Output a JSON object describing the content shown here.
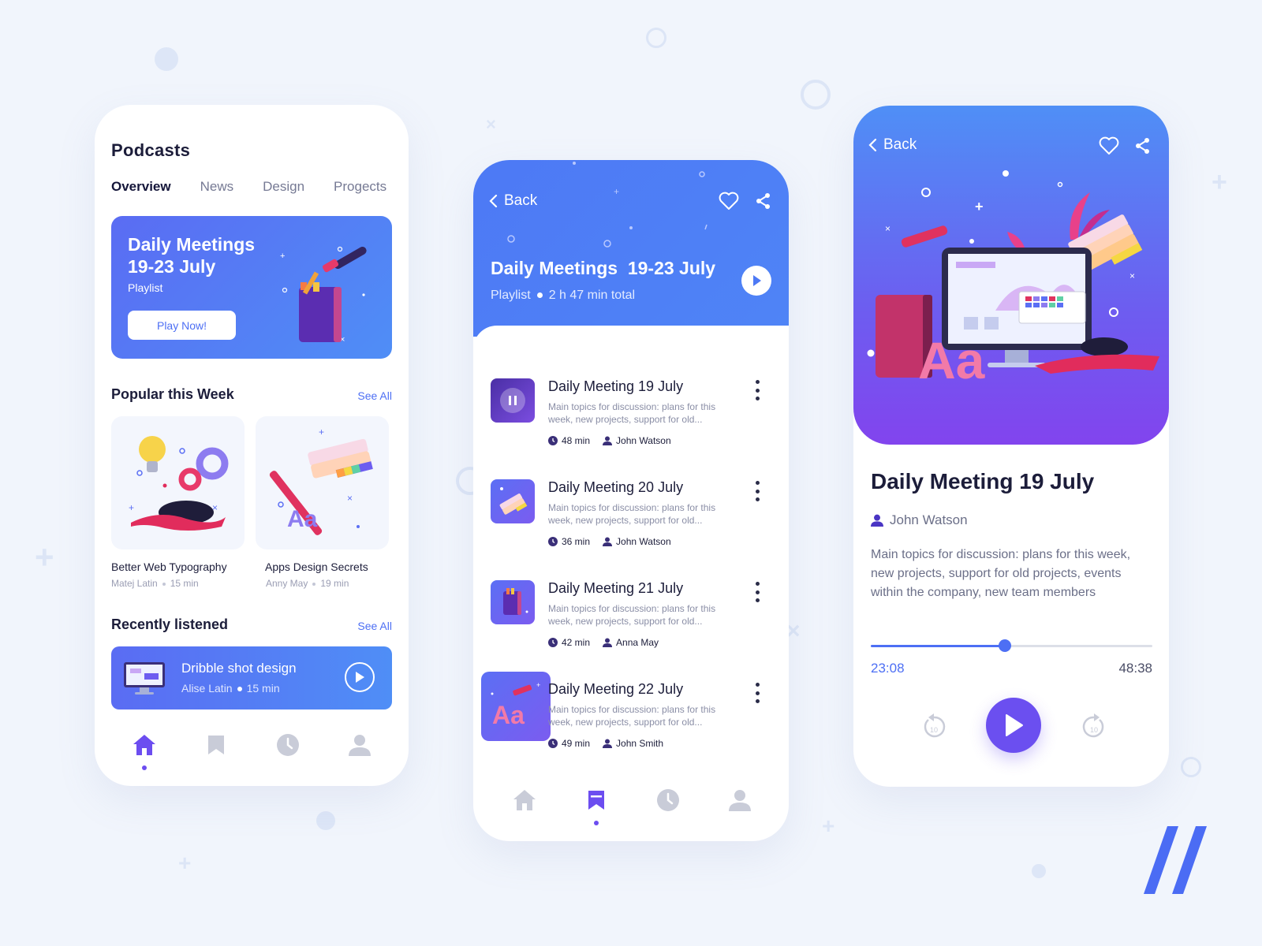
{
  "colors": {
    "accent": "#4d6ff4",
    "purple": "#6b4ff0",
    "bg": "#f1f5fc"
  },
  "overview": {
    "title": "Podcasts",
    "tabs": [
      "Overview",
      "News",
      "Design",
      "Progects"
    ],
    "hero": {
      "title": "Daily Meetings 19-23 July",
      "subtitle": "Playlist",
      "button": "Play Now!"
    },
    "popular": {
      "title": "Popular this Week",
      "see_all": "See All",
      "items": [
        {
          "title": "Better Web Typography",
          "author": "Matej Latin",
          "duration": "15 min"
        },
        {
          "title": "Apps Design Secrets",
          "author": "Anny May",
          "duration": "19 min"
        }
      ]
    },
    "recent": {
      "title": "Recently listened",
      "see_all": "See All",
      "item": {
        "title": "Dribble shot design",
        "author": "Alise Latin",
        "duration": "15 min"
      }
    },
    "nav": [
      "home-icon",
      "bookmark-icon",
      "clock-icon",
      "user-icon"
    ],
    "active_nav": "home"
  },
  "playlist": {
    "back": "Back",
    "title": "Daily Meetings  19-23 July",
    "subtitle": "Playlist",
    "total": "2 h 47 min total",
    "episodes": [
      {
        "title": "Daily Meeting 19 July",
        "desc": "Main topics for discussion: plans for this week, new projects, support for old...",
        "duration": "48 min",
        "author": "John Watson"
      },
      {
        "title": "Daily Meeting 20 July",
        "desc": "Main topics for discussion: plans for this week, new projects, support for old...",
        "duration": "36 min",
        "author": "John Watson"
      },
      {
        "title": "Daily Meeting 21 July",
        "desc": "Main topics for discussion: plans for this week, new projects, support for old...",
        "duration": "42 min",
        "author": "Anna May"
      },
      {
        "title": "Daily Meeting 22 July",
        "desc": "Main topics for discussion: plans for this week, new projects, support for old...",
        "duration": "49 min",
        "author": "John Smith"
      }
    ],
    "active_nav": "bookmark"
  },
  "player": {
    "back": "Back",
    "title": "Daily Meeting 19 July",
    "author": "John Watson",
    "desc": "Main topics for discussion: plans for this week, new projects, support for old projects, events within the company, new team members",
    "current_time": "23:08",
    "total_time": "48:38",
    "progress": 0.475,
    "skip_back": "10",
    "skip_forward": "10"
  }
}
